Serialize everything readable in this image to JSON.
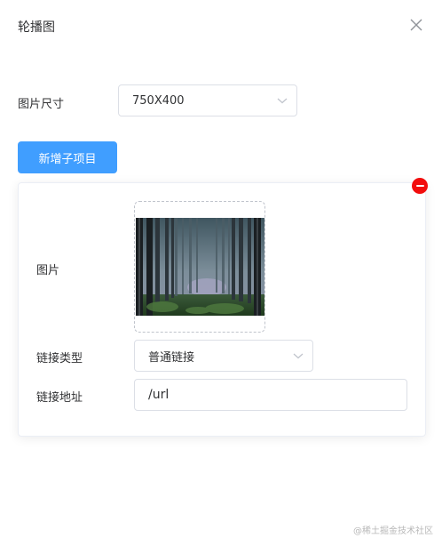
{
  "dialog": {
    "title": "轮播图",
    "close_icon": "close-icon"
  },
  "image_size": {
    "label": "图片尺寸",
    "selected": "750X400"
  },
  "add_button": {
    "label": "新增子项目"
  },
  "item": {
    "image_label": "图片",
    "link_type_label": "链接类型",
    "link_type_value": "普通链接",
    "link_url_label": "链接地址",
    "link_url_value": "/url",
    "remove_icon": "minus-circle-icon"
  },
  "watermark": "@稀土掘金技术社区",
  "colors": {
    "primary": "#409eff",
    "danger": "#f20d0d",
    "border": "#dcdfe6"
  }
}
